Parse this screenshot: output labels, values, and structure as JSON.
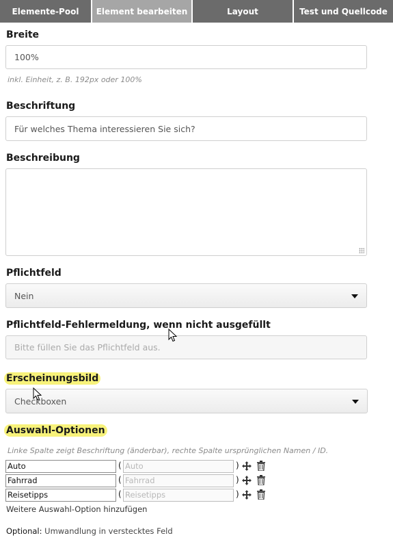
{
  "tabs": [
    {
      "label": "Elemente-Pool",
      "active": false
    },
    {
      "label": "Element bearbeiten",
      "active": true
    },
    {
      "label": "Layout",
      "active": false
    },
    {
      "label": "Test und Quellcode",
      "active": false
    }
  ],
  "fields": {
    "width": {
      "label": "Breite",
      "value": "100%",
      "hint": "inkl. Einheit, z. B. 192px oder 100%"
    },
    "caption": {
      "label": "Beschriftung",
      "value": "Für welches Thema interessieren Sie sich?"
    },
    "description": {
      "label": "Beschreibung",
      "value": ""
    },
    "required": {
      "label": "Pflichtfeld",
      "value": "Nein"
    },
    "required_error": {
      "label": "Pflichtfeld-Fehlermeldung, wenn nicht ausgefüllt",
      "placeholder": "Bitte füllen Sie das Pflichtfeld aus."
    },
    "appearance": {
      "label": "Erscheinungsbild",
      "value": "Checkboxen",
      "highlighted": true
    },
    "options": {
      "label": "Auswahl-Optionen",
      "highlighted": true,
      "hint": "Linke Spalte zeigt Beschriftung (änderbar), rechte Spalte ursprünglichen Namen / ID.",
      "items": [
        {
          "label": "Auto",
          "name": "Auto"
        },
        {
          "label": "Fahrrad",
          "name": "Fahrrad"
        },
        {
          "label": "Reisetipps",
          "name": "Reisetipps"
        }
      ],
      "add_link": "Weitere Auswahl-Option hinzufügen"
    }
  },
  "optional": {
    "prefix": "Optional:",
    "link": "Umwandlung in verstecktes Feld"
  },
  "colors": {
    "tab_bg": "#6b6b6b",
    "tab_active_bg": "#a6a6a6",
    "highlight": "#f7f27a"
  },
  "icons": [
    "move-icon",
    "trash-icon",
    "dropdown-arrow-icon",
    "mouse-cursor-icon",
    "resize-grip-icon"
  ]
}
